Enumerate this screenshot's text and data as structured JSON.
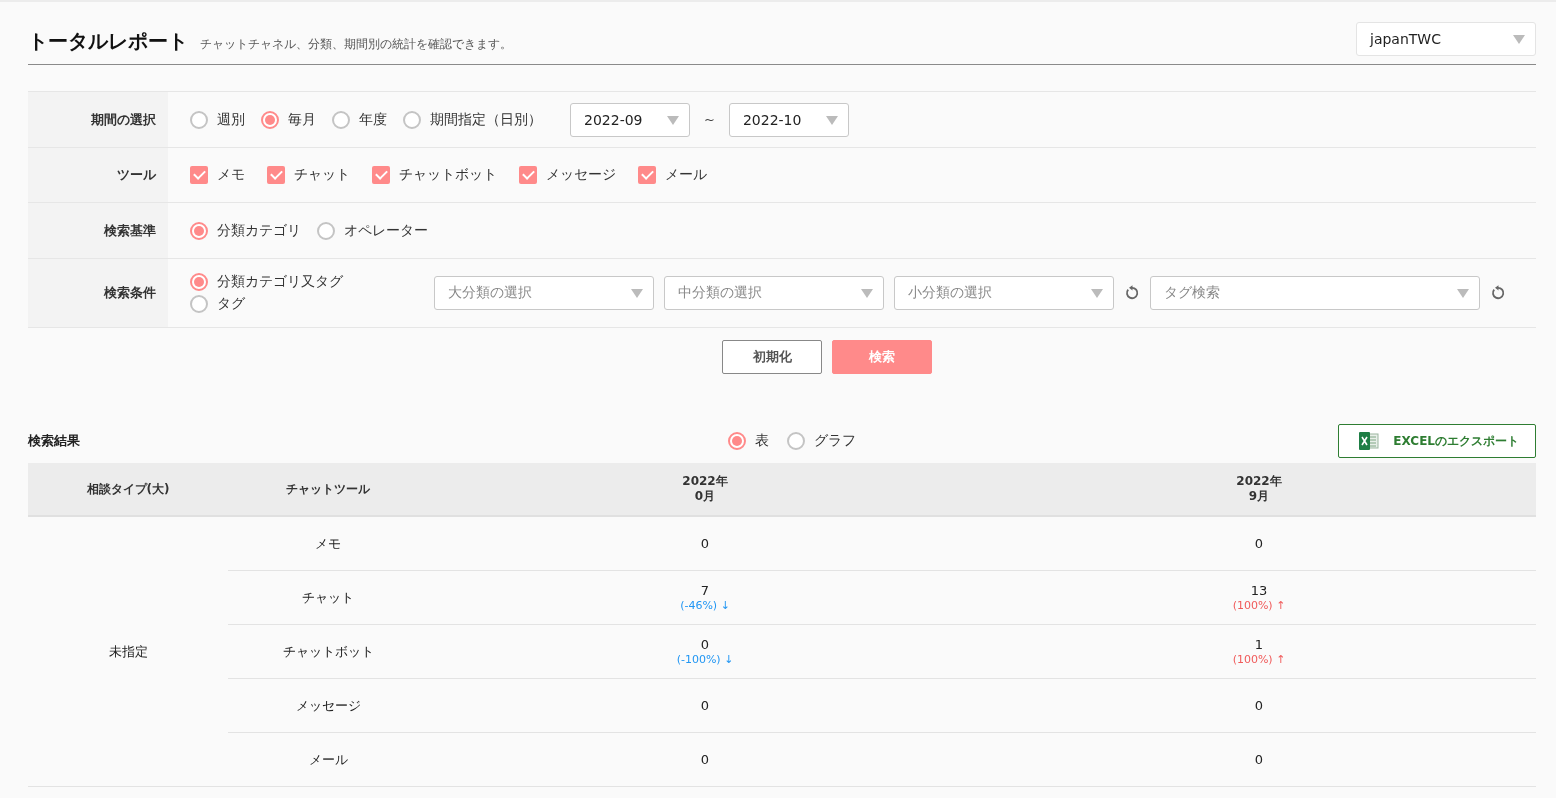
{
  "header": {
    "title": "トータルレポート",
    "subtitle": "チャットチャネル、分類、期間別の統計を確認できます。",
    "account_select": "japanTWC"
  },
  "filters": {
    "period": {
      "label": "期間の選択",
      "options": [
        {
          "label": "週別",
          "selected": false
        },
        {
          "label": "毎月",
          "selected": true
        },
        {
          "label": "年度",
          "selected": false
        },
        {
          "label": "期間指定（日別）",
          "selected": false
        }
      ],
      "from": "2022-09",
      "separator": "~",
      "to": "2022-10"
    },
    "tools": {
      "label": "ツール",
      "items": [
        {
          "label": "メモ",
          "checked": true
        },
        {
          "label": "チャット",
          "checked": true
        },
        {
          "label": "チャットボット",
          "checked": true
        },
        {
          "label": "メッセージ",
          "checked": true
        },
        {
          "label": "メール",
          "checked": true
        }
      ]
    },
    "basis": {
      "label": "検索基準",
      "options": [
        {
          "label": "分類カテゴリ",
          "selected": true
        },
        {
          "label": "オペレーター",
          "selected": false
        }
      ]
    },
    "condition": {
      "label": "検索条件",
      "options": [
        {
          "label": "分類カテゴリ又タグ",
          "selected": true
        },
        {
          "label": "タグ",
          "selected": false
        }
      ],
      "category_selects": [
        {
          "placeholder": "大分類の選択"
        },
        {
          "placeholder": "中分類の選択"
        },
        {
          "placeholder": "小分類の選択"
        }
      ],
      "tag_select": {
        "placeholder": "タグ検索"
      }
    }
  },
  "actions": [
    {
      "label": "初期化",
      "kind": "secondary"
    },
    {
      "label": "検索",
      "kind": "primary"
    }
  ],
  "results": {
    "title": "検索結果",
    "view_options": [
      {
        "label": "表",
        "selected": true
      },
      {
        "label": "グラフ",
        "selected": false
      }
    ],
    "export_button": "EXCELのエクスポート"
  },
  "table": {
    "columns": [
      {
        "lines": [
          "相談タイプ(大)"
        ]
      },
      {
        "lines": [
          "チャットツール"
        ]
      },
      {
        "lines": [
          "2022年",
          "0月"
        ]
      },
      {
        "lines": [
          "2022年",
          "9月"
        ]
      }
    ],
    "groups": [
      {
        "name": "未指定",
        "rows": [
          {
            "tool": "メモ",
            "cells": [
              {
                "value": "0"
              },
              {
                "value": "0"
              }
            ]
          },
          {
            "tool": "チャット",
            "cells": [
              {
                "value": "7",
                "change": "(-46%) ↓",
                "color": "#2196f3"
              },
              {
                "value": "13",
                "change": "(100%) ↑",
                "color": "#f05a5a"
              }
            ]
          },
          {
            "tool": "チャットボット",
            "cells": [
              {
                "value": "0",
                "change": "(-100%) ↓",
                "color": "#2196f3"
              },
              {
                "value": "1",
                "change": "(100%) ↑",
                "color": "#f05a5a"
              }
            ]
          },
          {
            "tool": "メッセージ",
            "cells": [
              {
                "value": "0"
              },
              {
                "value": "0"
              }
            ]
          },
          {
            "tool": "メール",
            "cells": [
              {
                "value": "0"
              },
              {
                "value": "0"
              }
            ]
          }
        ]
      }
    ]
  }
}
